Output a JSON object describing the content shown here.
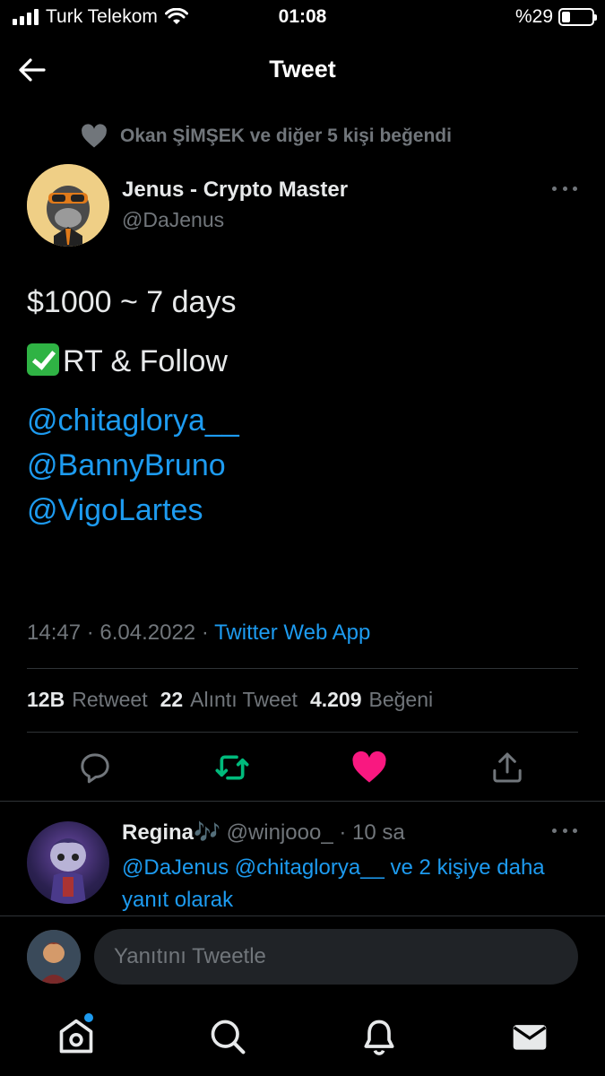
{
  "status_bar": {
    "carrier": "Turk Telekom",
    "time": "01:08",
    "battery_text": "%29",
    "battery_level": 0.29
  },
  "header": {
    "title": "Tweet"
  },
  "social_context": {
    "text": "Okan ŞİMŞEK ve diğer 5 kişi beğendi"
  },
  "tweet": {
    "author_name": "Jenus - Crypto Master",
    "author_handle": "@DaJenus",
    "line1": "$1000 ~ 7 days",
    "line2": "RT & Follow",
    "mentions": [
      "@chitaglorya__",
      "@BannyBruno",
      "@VigoLartes"
    ],
    "timestamp": "14:47 · 6.04.2022 · ",
    "source": "Twitter Web App",
    "retweet_count": "12B",
    "retweet_label": "Retweet",
    "quote_count": "22",
    "quote_label": "Alıntı Tweet",
    "like_count": "4.209",
    "like_label": "Beğeni"
  },
  "reply": {
    "name": "Regina🎶",
    "handle_time": " @winjooo_ · 10 sa",
    "context": "@DaJenus @chitaglorya__ ve 2 kişiye daha yanıt olarak"
  },
  "composer": {
    "placeholder": "Yanıtını Tweetle"
  },
  "colors": {
    "accent": "#1d9bf0",
    "like": "#f91880",
    "retweet": "#00ba7c",
    "background": "#000000"
  }
}
